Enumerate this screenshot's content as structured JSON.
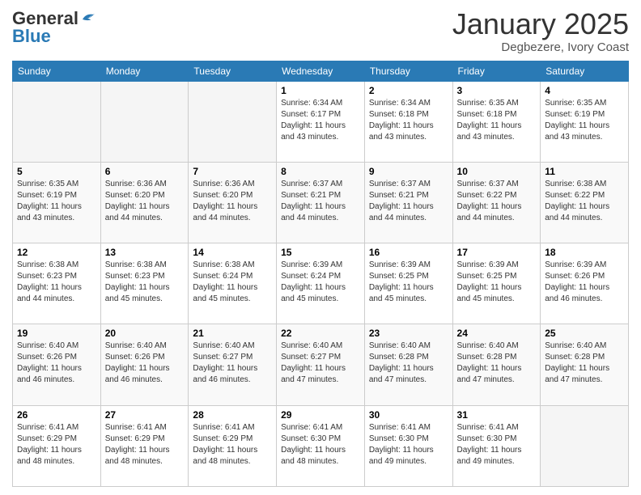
{
  "header": {
    "logo_line1": "General",
    "logo_line2": "Blue",
    "month_title": "January 2025",
    "subtitle": "Degbezere, Ivory Coast"
  },
  "days_of_week": [
    "Sunday",
    "Monday",
    "Tuesday",
    "Wednesday",
    "Thursday",
    "Friday",
    "Saturday"
  ],
  "weeks": [
    [
      {
        "day": "",
        "info": ""
      },
      {
        "day": "",
        "info": ""
      },
      {
        "day": "",
        "info": ""
      },
      {
        "day": "1",
        "info": "Sunrise: 6:34 AM\nSunset: 6:17 PM\nDaylight: 11 hours\nand 43 minutes."
      },
      {
        "day": "2",
        "info": "Sunrise: 6:34 AM\nSunset: 6:18 PM\nDaylight: 11 hours\nand 43 minutes."
      },
      {
        "day": "3",
        "info": "Sunrise: 6:35 AM\nSunset: 6:18 PM\nDaylight: 11 hours\nand 43 minutes."
      },
      {
        "day": "4",
        "info": "Sunrise: 6:35 AM\nSunset: 6:19 PM\nDaylight: 11 hours\nand 43 minutes."
      }
    ],
    [
      {
        "day": "5",
        "info": "Sunrise: 6:35 AM\nSunset: 6:19 PM\nDaylight: 11 hours\nand 43 minutes."
      },
      {
        "day": "6",
        "info": "Sunrise: 6:36 AM\nSunset: 6:20 PM\nDaylight: 11 hours\nand 44 minutes."
      },
      {
        "day": "7",
        "info": "Sunrise: 6:36 AM\nSunset: 6:20 PM\nDaylight: 11 hours\nand 44 minutes."
      },
      {
        "day": "8",
        "info": "Sunrise: 6:37 AM\nSunset: 6:21 PM\nDaylight: 11 hours\nand 44 minutes."
      },
      {
        "day": "9",
        "info": "Sunrise: 6:37 AM\nSunset: 6:21 PM\nDaylight: 11 hours\nand 44 minutes."
      },
      {
        "day": "10",
        "info": "Sunrise: 6:37 AM\nSunset: 6:22 PM\nDaylight: 11 hours\nand 44 minutes."
      },
      {
        "day": "11",
        "info": "Sunrise: 6:38 AM\nSunset: 6:22 PM\nDaylight: 11 hours\nand 44 minutes."
      }
    ],
    [
      {
        "day": "12",
        "info": "Sunrise: 6:38 AM\nSunset: 6:23 PM\nDaylight: 11 hours\nand 44 minutes."
      },
      {
        "day": "13",
        "info": "Sunrise: 6:38 AM\nSunset: 6:23 PM\nDaylight: 11 hours\nand 45 minutes."
      },
      {
        "day": "14",
        "info": "Sunrise: 6:38 AM\nSunset: 6:24 PM\nDaylight: 11 hours\nand 45 minutes."
      },
      {
        "day": "15",
        "info": "Sunrise: 6:39 AM\nSunset: 6:24 PM\nDaylight: 11 hours\nand 45 minutes."
      },
      {
        "day": "16",
        "info": "Sunrise: 6:39 AM\nSunset: 6:25 PM\nDaylight: 11 hours\nand 45 minutes."
      },
      {
        "day": "17",
        "info": "Sunrise: 6:39 AM\nSunset: 6:25 PM\nDaylight: 11 hours\nand 45 minutes."
      },
      {
        "day": "18",
        "info": "Sunrise: 6:39 AM\nSunset: 6:26 PM\nDaylight: 11 hours\nand 46 minutes."
      }
    ],
    [
      {
        "day": "19",
        "info": "Sunrise: 6:40 AM\nSunset: 6:26 PM\nDaylight: 11 hours\nand 46 minutes."
      },
      {
        "day": "20",
        "info": "Sunrise: 6:40 AM\nSunset: 6:26 PM\nDaylight: 11 hours\nand 46 minutes."
      },
      {
        "day": "21",
        "info": "Sunrise: 6:40 AM\nSunset: 6:27 PM\nDaylight: 11 hours\nand 46 minutes."
      },
      {
        "day": "22",
        "info": "Sunrise: 6:40 AM\nSunset: 6:27 PM\nDaylight: 11 hours\nand 47 minutes."
      },
      {
        "day": "23",
        "info": "Sunrise: 6:40 AM\nSunset: 6:28 PM\nDaylight: 11 hours\nand 47 minutes."
      },
      {
        "day": "24",
        "info": "Sunrise: 6:40 AM\nSunset: 6:28 PM\nDaylight: 11 hours\nand 47 minutes."
      },
      {
        "day": "25",
        "info": "Sunrise: 6:40 AM\nSunset: 6:28 PM\nDaylight: 11 hours\nand 47 minutes."
      }
    ],
    [
      {
        "day": "26",
        "info": "Sunrise: 6:41 AM\nSunset: 6:29 PM\nDaylight: 11 hours\nand 48 minutes."
      },
      {
        "day": "27",
        "info": "Sunrise: 6:41 AM\nSunset: 6:29 PM\nDaylight: 11 hours\nand 48 minutes."
      },
      {
        "day": "28",
        "info": "Sunrise: 6:41 AM\nSunset: 6:29 PM\nDaylight: 11 hours\nand 48 minutes."
      },
      {
        "day": "29",
        "info": "Sunrise: 6:41 AM\nSunset: 6:30 PM\nDaylight: 11 hours\nand 48 minutes."
      },
      {
        "day": "30",
        "info": "Sunrise: 6:41 AM\nSunset: 6:30 PM\nDaylight: 11 hours\nand 49 minutes."
      },
      {
        "day": "31",
        "info": "Sunrise: 6:41 AM\nSunset: 6:30 PM\nDaylight: 11 hours\nand 49 minutes."
      },
      {
        "day": "",
        "info": ""
      }
    ]
  ]
}
